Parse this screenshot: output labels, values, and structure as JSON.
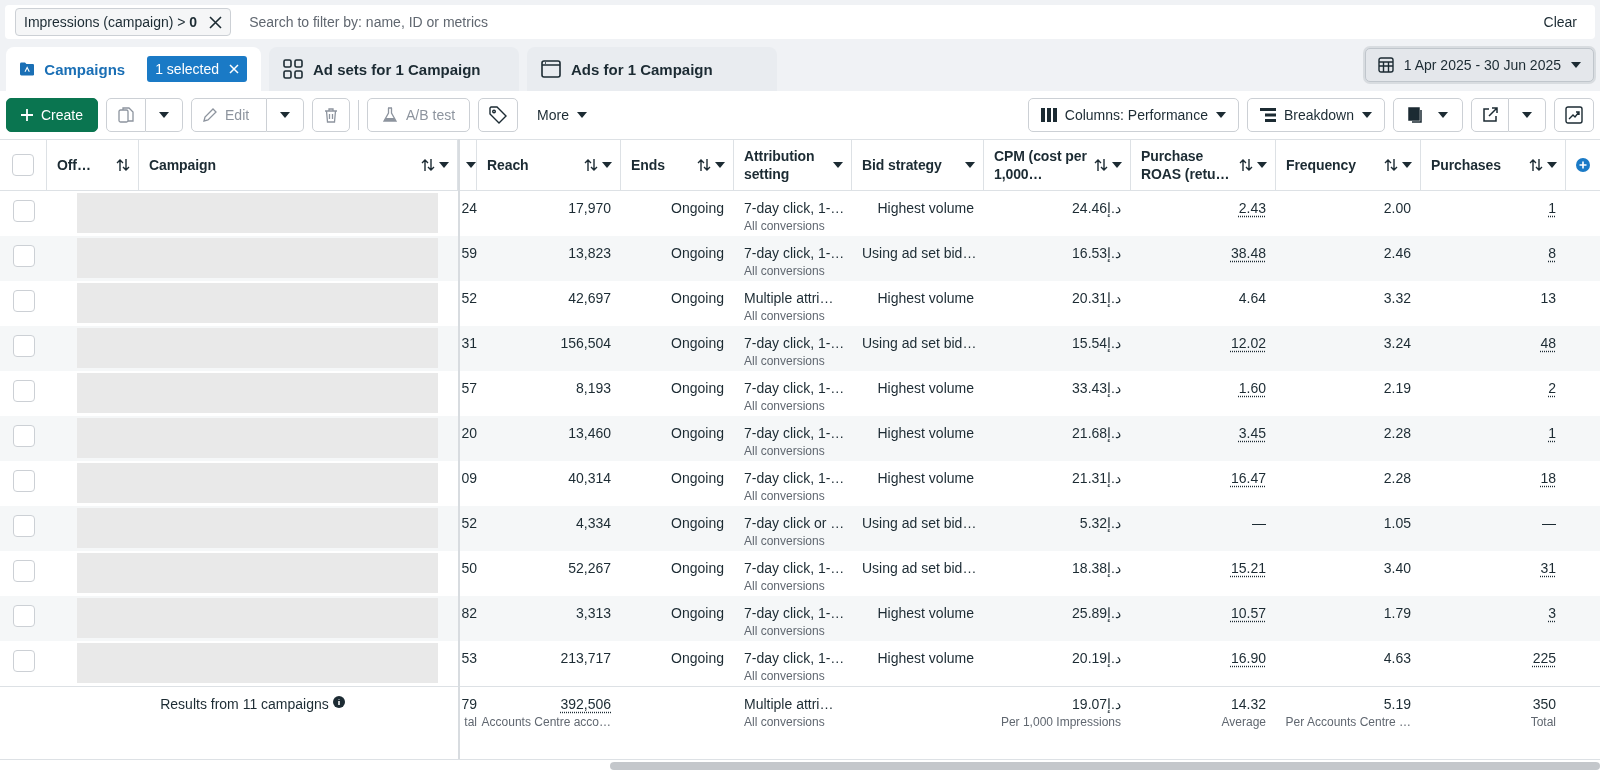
{
  "filter_bar": {
    "chip": {
      "label": "Impressions (campaign) > ",
      "value": "0"
    },
    "placeholder": "Search to filter by: name, ID or metrics",
    "clear": "Clear"
  },
  "tabs": [
    {
      "label": "Campaigns",
      "kind": "folder",
      "selected": true,
      "badge": "1 selected"
    },
    {
      "label": "Ad sets for 1 Campaign",
      "kind": "grid",
      "selected": false
    },
    {
      "label": "Ads for 1 Campaign",
      "kind": "window",
      "selected": false
    }
  ],
  "date_range": "1 Apr 2025 - 30 Jun 2025",
  "toolbar": {
    "create": "Create",
    "edit": {
      "label": "Edit",
      "disabled": true
    },
    "duplicate_disabled": true,
    "delete_disabled": true,
    "ab_test": {
      "label": "A/B test",
      "disabled": true
    },
    "more": "More",
    "columns": "Columns: Performance",
    "breakdown": "Breakdown"
  },
  "table": {
    "select_all": {
      "checked": false
    },
    "columns": [
      {
        "label": "Off…",
        "sortable": true,
        "menu": false
      },
      {
        "label": "Campaign",
        "sortable": true,
        "menu": true
      },
      {
        "sortable": false,
        "menu": true
      },
      {
        "label": "Reach",
        "sortable": true,
        "menu": true
      },
      {
        "label": "Ends",
        "sortable": true,
        "menu": true
      },
      {
        "label": "Attribution setting",
        "sortable": false,
        "menu": true
      },
      {
        "label": "Bid strategy",
        "sortable": false,
        "menu": true
      },
      {
        "label": "CPM (cost per 1,000…",
        "sortable": true,
        "menu": true
      },
      {
        "label": "Purchase ROAS (retu…",
        "sortable": true,
        "menu": true
      },
      {
        "label": "Frequency",
        "sortable": true,
        "menu": true
      },
      {
        "label": "Purchases",
        "sortable": true,
        "menu": true
      }
    ],
    "rows": [
      {
        "checked": false,
        "redacted": true,
        "column_3": "24",
        "reach": "17,970",
        "ends": "Ongoing",
        "attribution": "7-day click, 1-…",
        "attribution_sub": "All conversions",
        "bid_strategy": "Highest volume",
        "cpm": "24.46د.إ",
        "roas": {
          "value": "2.43",
          "dotted": true
        },
        "frequency": "2.00",
        "purchases": {
          "value": "1",
          "dotted": true
        }
      },
      {
        "checked": false,
        "redacted": true,
        "column_3": "59",
        "reach": "13,823",
        "ends": "Ongoing",
        "attribution": "7-day click, 1-…",
        "attribution_sub": "All conversions",
        "bid_strategy": "Using ad set bid…",
        "cpm": "16.53د.إ",
        "roas": {
          "value": "38.48",
          "dotted": true
        },
        "frequency": "2.46",
        "purchases": {
          "value": "8",
          "dotted": true
        }
      },
      {
        "checked": false,
        "redacted": true,
        "column_3": "52",
        "reach": "42,697",
        "ends": "Ongoing",
        "attribution": "Multiple attri…",
        "attribution_sub": "All conversions",
        "bid_strategy": "Highest volume",
        "cpm": "20.31د.إ",
        "roas": {
          "value": "4.64",
          "dotted": false
        },
        "frequency": "3.32",
        "purchases": {
          "value": "13",
          "dotted": false
        }
      },
      {
        "checked": false,
        "redacted": true,
        "column_3": "31",
        "reach": "156,504",
        "ends": "Ongoing",
        "attribution": "7-day click, 1-…",
        "attribution_sub": "All conversions",
        "bid_strategy": "Using ad set bid…",
        "cpm": "15.54د.إ",
        "roas": {
          "value": "12.02",
          "dotted": true
        },
        "frequency": "3.24",
        "purchases": {
          "value": "48",
          "dotted": true
        }
      },
      {
        "checked": false,
        "redacted": true,
        "column_3": "57",
        "reach": "8,193",
        "ends": "Ongoing",
        "attribution": "7-day click, 1-…",
        "attribution_sub": "All conversions",
        "bid_strategy": "Highest volume",
        "cpm": "33.43د.إ",
        "roas": {
          "value": "1.60",
          "dotted": true
        },
        "frequency": "2.19",
        "purchases": {
          "value": "2",
          "dotted": true
        }
      },
      {
        "checked": false,
        "redacted": true,
        "column_3": "20",
        "reach": "13,460",
        "ends": "Ongoing",
        "attribution": "7-day click, 1-…",
        "attribution_sub": "All conversions",
        "bid_strategy": "Highest volume",
        "cpm": "21.68د.إ",
        "roas": {
          "value": "3.45",
          "dotted": true
        },
        "frequency": "2.28",
        "purchases": {
          "value": "1",
          "dotted": true
        }
      },
      {
        "checked": false,
        "redacted": true,
        "column_3": "09",
        "reach": "40,314",
        "ends": "Ongoing",
        "attribution": "7-day click, 1-…",
        "attribution_sub": "All conversions",
        "bid_strategy": "Highest volume",
        "cpm": "21.31د.إ",
        "roas": {
          "value": "16.47",
          "dotted": true
        },
        "frequency": "2.28",
        "purchases": {
          "value": "18",
          "dotted": true
        }
      },
      {
        "checked": false,
        "redacted": true,
        "column_3": "52",
        "reach": "4,334",
        "ends": "Ongoing",
        "attribution": "7-day click or …",
        "attribution_sub": "All conversions",
        "bid_strategy": "Using ad set bid…",
        "cpm": "5.32د.إ",
        "roas": {
          "value": "—",
          "dotted": false
        },
        "frequency": "1.05",
        "purchases": {
          "value": "—",
          "dotted": false
        }
      },
      {
        "checked": false,
        "redacted": true,
        "column_3": "50",
        "reach": "52,267",
        "ends": "Ongoing",
        "attribution": "7-day click, 1-…",
        "attribution_sub": "All conversions",
        "bid_strategy": "Using ad set bid…",
        "cpm": "18.38د.إ",
        "roas": {
          "value": "15.21",
          "dotted": true
        },
        "frequency": "3.40",
        "purchases": {
          "value": "31",
          "dotted": true
        }
      },
      {
        "checked": false,
        "redacted": true,
        "column_3": "82",
        "reach": "3,313",
        "ends": "Ongoing",
        "attribution": "7-day click, 1-…",
        "attribution_sub": "All conversions",
        "bid_strategy": "Highest volume",
        "cpm": "25.89د.إ",
        "roas": {
          "value": "10.57",
          "dotted": true
        },
        "frequency": "1.79",
        "purchases": {
          "value": "3",
          "dotted": true
        }
      },
      {
        "checked": false,
        "redacted": true,
        "column_3": "53",
        "reach": "213,717",
        "ends": "Ongoing",
        "attribution": "7-day click, 1-…",
        "attribution_sub": "All conversions",
        "bid_strategy": "Highest volume",
        "cpm": "20.19د.إ",
        "roas": {
          "value": "16.90",
          "dotted": true
        },
        "frequency": "4.63",
        "purchases": {
          "value": "225",
          "dotted": true
        }
      }
    ],
    "summary": {
      "label": "Results from 11 campaigns",
      "column_3": "79",
      "column_3_sub": "tal",
      "reach": "392,506",
      "reach_sub": "Accounts Centre acco…",
      "attribution": "Multiple attri…",
      "attribution_sub": "All conversions",
      "cpm": "19.07د.إ",
      "cpm_sub": "Per 1,000 Impressions",
      "roas": "14.32",
      "roas_sub": "Average",
      "frequency": "5.19",
      "frequency_sub": "Per Accounts Centre …",
      "purchases": "350",
      "purchases_sub": "Total"
    }
  }
}
